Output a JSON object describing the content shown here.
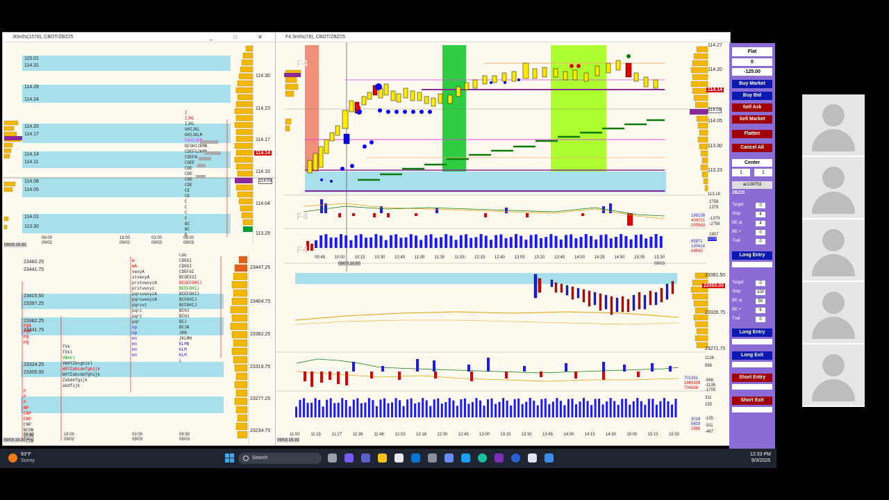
{
  "left_window": {
    "title": "30m0s(1578), CBOT/ZBZ25",
    "top_prices": [
      "115.01",
      "114.31",
      "114.28",
      "114.24",
      "114.20",
      "114.17",
      "114.14",
      "114.11",
      "114.08",
      "114.05",
      "114.01",
      "113.30"
    ],
    "top_axis": [
      "114.30",
      "114.23",
      "114.17",
      "114.14",
      "114.10",
      "114.09",
      "114.04",
      "113.29"
    ],
    "top_times": [
      "08:00\n09/02",
      "18:00\n09/02",
      "03:00\n09/03",
      "08:00\n09/03"
    ],
    "top_stamp": "09/03 15:30",
    "bottom_prices": [
      "23460.25",
      "23441.75",
      "23415.50",
      "23397.25",
      "23382.25",
      "23341.75",
      "23324.25",
      "23305.00"
    ],
    "bottom_axis": [
      "23447.25",
      "23404.75",
      "23362.25",
      "23319.75",
      "23277.25",
      "23234.75"
    ],
    "bottom_times": [
      "09:30\n09/02",
      "18:00\n09/02",
      "03:00\n09/03",
      "09:30\n09/03"
    ],
    "bottom_stamp": "09/03 15:30"
  },
  "right_window": {
    "title": "F4 5m0s(78), CBOT/ZBZ25",
    "price_axis": [
      "114.27",
      "114.20",
      "114.14",
      "114.09",
      "114.05",
      "113.30",
      "113.23",
      "113.16"
    ],
    "current_price": "114.14",
    "osc1_values": [
      "2758",
      "1379",
      "0",
      "-1379",
      "-2758"
    ],
    "osc1_readouts": [
      "199138",
      "404701",
      "205563"
    ],
    "osc2_values": [
      "1807",
      "1155",
      "0",
      "-1807"
    ],
    "osc2_readouts": [
      "65871",
      "130414",
      "64543"
    ],
    "times": [
      "09:45",
      "10:00",
      "10:15",
      "10:30",
      "10:45",
      "11:05",
      "11:30",
      "11:55",
      "12:15",
      "12:40",
      "13:05",
      "13:20",
      "13:45",
      "14:00",
      "14:25",
      "14:50",
      "15:05",
      "15:30"
    ],
    "date_stamp": "09/03",
    "time_stamp": "09/03 10:00",
    "es_axis": [
      "23381.50",
      "23365.00",
      "23326.75",
      "23271.75"
    ],
    "es_current": "23365.00",
    "es_osc1_values": [
      "1136",
      "568",
      "0",
      "-568",
      "-1136",
      "-1705"
    ],
    "es_osc1_readouts": [
      "701391",
      "1465509",
      "704168"
    ],
    "es_osc2_values": [
      "311",
      "155",
      "0",
      "-155",
      "-311",
      "-467"
    ],
    "es_osc2_readouts": [
      "3018",
      "5603",
      "2585"
    ],
    "es_times": [
      "11:00",
      "11:15",
      "11:27",
      "11:36",
      "11:48",
      "12:03",
      "12:18",
      "12:30",
      "12:45",
      "13:00",
      "13:15",
      "13:30",
      "13:45",
      "14:00",
      "14:15",
      "14:30",
      "15:00",
      "15:15",
      "15:33"
    ],
    "es_stamp": "09/03 15:33",
    "pane_watermark": "F4"
  },
  "dom_panel": {
    "status": "Flat",
    "position": "0",
    "pnl": "-125.00",
    "buy_market": "Buy Market",
    "buy_bid": "Buy Bid",
    "sell_ask": "Sell Ask",
    "sell_market": "Sell Market",
    "flatten": "Flatten",
    "cancel_all": "Cancel All",
    "center": "Center",
    "qty_a": "1",
    "qty_b": "1",
    "account": "ac138753",
    "symbol": "ZBZ25",
    "fields_1": [
      {
        "label": "Target",
        "value": "0"
      },
      {
        "label": "Stop",
        "value": "4"
      },
      {
        "label": "BE at",
        "value": "4"
      },
      {
        "label": "BE +",
        "value": "0"
      },
      {
        "label": "Trail",
        "value": "0"
      }
    ],
    "long_entry_1": "Long Entry",
    "fields_2": [
      {
        "label": "Target",
        "value": "0"
      },
      {
        "label": "Stop",
        "value": "100"
      },
      {
        "label": "BE at",
        "value": "50"
      },
      {
        "label": "BE +",
        "value": "6"
      },
      {
        "label": "Trail",
        "value": "0"
      }
    ],
    "long_entry_2": "Long Entry",
    "long_exit": "Long Exit",
    "short_entry": "Short Entry",
    "short_exit": "Short Exit"
  },
  "taskbar": {
    "weather_temp": "93°F",
    "weather_desc": "Sunny",
    "search_placeholder": "Search",
    "clock_time": "12:33 PM",
    "clock_date": "9/3/2025"
  },
  "colors": {
    "band": "#a7e0ea",
    "volume_bar": "#f2b705",
    "up_bar": "#1a1aff",
    "down_bar": "#e00000",
    "green_zone": "#2ecc40",
    "lime_zone": "#adff2f",
    "salmon_zone": "#f0907a",
    "dom_bg": "#8b6bd6"
  }
}
